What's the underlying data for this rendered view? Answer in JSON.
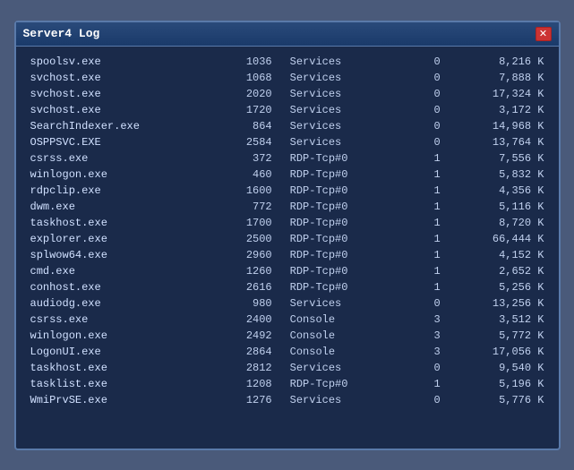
{
  "window": {
    "title": "Server4 Log",
    "close_label": "✕"
  },
  "rows": [
    {
      "process": "spoolsv.exe",
      "pid": "1036",
      "session": "Services",
      "num": "0",
      "mem": "8,216 K"
    },
    {
      "process": "svchost.exe",
      "pid": "1068",
      "session": "Services",
      "num": "0",
      "mem": "7,888 K"
    },
    {
      "process": "svchost.exe",
      "pid": "2020",
      "session": "Services",
      "num": "0",
      "mem": "17,324 K"
    },
    {
      "process": "svchost.exe",
      "pid": "1720",
      "session": "Services",
      "num": "0",
      "mem": "3,172 K"
    },
    {
      "process": "SearchIndexer.exe",
      "pid": "864",
      "session": "Services",
      "num": "0",
      "mem": "14,968 K"
    },
    {
      "process": "OSPPSVC.EXE",
      "pid": "2584",
      "session": "Services",
      "num": "0",
      "mem": "13,764 K"
    },
    {
      "process": "csrss.exe",
      "pid": "372",
      "session": "RDP-Tcp#0",
      "num": "1",
      "mem": "7,556 K"
    },
    {
      "process": "winlogon.exe",
      "pid": "460",
      "session": "RDP-Tcp#0",
      "num": "1",
      "mem": "5,832 K"
    },
    {
      "process": "rdpclip.exe",
      "pid": "1600",
      "session": "RDP-Tcp#0",
      "num": "1",
      "mem": "4,356 K"
    },
    {
      "process": "dwm.exe",
      "pid": "772",
      "session": "RDP-Tcp#0",
      "num": "1",
      "mem": "5,116 K"
    },
    {
      "process": "taskhost.exe",
      "pid": "1700",
      "session": "RDP-Tcp#0",
      "num": "1",
      "mem": "8,720 K"
    },
    {
      "process": "explorer.exe",
      "pid": "2500",
      "session": "RDP-Tcp#0",
      "num": "1",
      "mem": "66,444 K"
    },
    {
      "process": "splwow64.exe",
      "pid": "2960",
      "session": "RDP-Tcp#0",
      "num": "1",
      "mem": "4,152 K"
    },
    {
      "process": "cmd.exe",
      "pid": "1260",
      "session": "RDP-Tcp#0",
      "num": "1",
      "mem": "2,652 K"
    },
    {
      "process": "conhost.exe",
      "pid": "2616",
      "session": "RDP-Tcp#0",
      "num": "1",
      "mem": "5,256 K"
    },
    {
      "process": "audiodg.exe",
      "pid": "980",
      "session": "Services",
      "num": "0",
      "mem": "13,256 K"
    },
    {
      "process": "csrss.exe",
      "pid": "2400",
      "session": "Console",
      "num": "3",
      "mem": "3,512 K"
    },
    {
      "process": "winlogon.exe",
      "pid": "2492",
      "session": "Console",
      "num": "3",
      "mem": "5,772 K"
    },
    {
      "process": "LogonUI.exe",
      "pid": "2864",
      "session": "Console",
      "num": "3",
      "mem": "17,056 K"
    },
    {
      "process": "taskhost.exe",
      "pid": "2812",
      "session": "Services",
      "num": "0",
      "mem": "9,540 K"
    },
    {
      "process": "tasklist.exe",
      "pid": "1208",
      "session": "RDP-Tcp#0",
      "num": "1",
      "mem": "5,196 K"
    },
    {
      "process": "WmiPrvSE.exe",
      "pid": "1276",
      "session": "Services",
      "num": "0",
      "mem": "5,776 K"
    }
  ]
}
